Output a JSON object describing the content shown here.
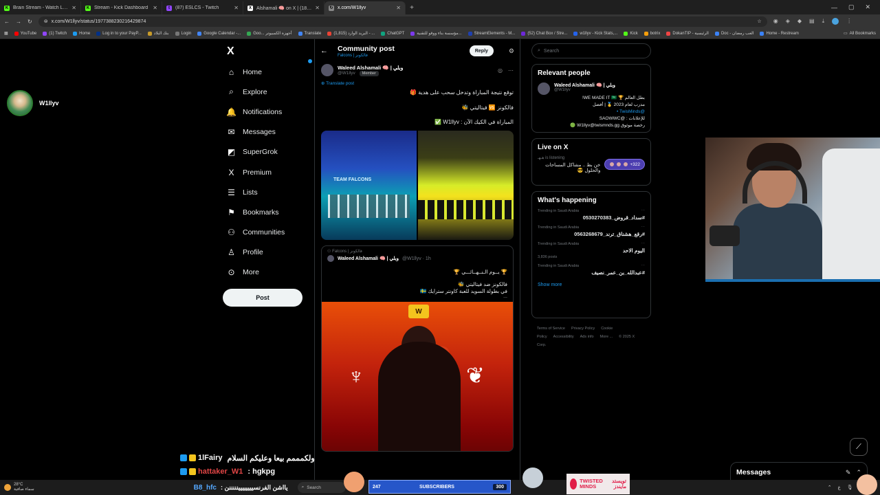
{
  "browser": {
    "tabs": [
      {
        "title": "Brain Stream - Watch Live on Kick",
        "fav_color": "#53fc18",
        "fav": "K",
        "active": false
      },
      {
        "title": "Stream - Kick Dashboard",
        "fav_color": "#53fc18",
        "fav": "K",
        "active": false
      },
      {
        "title": "(87) ESLCS - Twitch",
        "fav_color": "#9146ff",
        "fav": "t",
        "active": false
      },
      {
        "title": "Alshamali 🧠 on X | وبلي (18)",
        "fav_color": "#ffffff",
        "fav": "X",
        "active": false
      },
      {
        "title": "x.com/W1llyv",
        "fav_color": "#888888",
        "fav": "↻",
        "active": true
      }
    ],
    "new_tab": "+",
    "url": "x.com/W1llyv/status/1977388230216429874",
    "bookmarks": [
      {
        "label": "YouTube",
        "color": "#ff0000"
      },
      {
        "label": "(1) Twitch",
        "color": "#9146ff"
      },
      {
        "label": "Home",
        "color": "#1d9bf0"
      },
      {
        "label": "Log in to your PayP...",
        "color": "#003087"
      },
      {
        "label": "بنك البلاد",
        "color": "#c89b2a"
      },
      {
        "label": "Login",
        "color": "#777777"
      },
      {
        "label": "Google Calendar -...",
        "color": "#4285f4"
      },
      {
        "label": "Goo... أجهزة الكمبيوتر",
        "color": "#34a853"
      },
      {
        "label": "Translate",
        "color": "#4285f4"
      },
      {
        "label": "(1,815) البريد الوارد - ...",
        "color": "#ea4335"
      },
      {
        "label": "ChatGPT",
        "color": "#10a37f"
      },
      {
        "label": "مؤسسة بناء ووقو للتقنية...",
        "color": "#7c3aed"
      },
      {
        "label": "StreamElements - M...",
        "color": "#1e40af"
      },
      {
        "label": "(52) Chat Box / Stre...",
        "color": "#6d28d9"
      },
      {
        "label": "w1llyv - Kick Stats,...",
        "color": "#2563eb"
      },
      {
        "label": "Kick",
        "color": "#53fc18"
      },
      {
        "label": "botrix",
        "color": "#f59e0b"
      },
      {
        "label": "DokanTIP - الرئيسية",
        "color": "#ef4444"
      },
      {
        "label": "Doc - العب رمضان",
        "color": "#3b82f6"
      },
      {
        "label": "Home - Restream",
        "color": "#3b82f6"
      }
    ],
    "all_bookmarks": "All Bookmarks"
  },
  "streamer": {
    "name": "W1llyv"
  },
  "x_nav": {
    "logo": "X",
    "items": [
      {
        "label": "Home",
        "icon": "home-icon",
        "glyph": "⌂"
      },
      {
        "label": "Explore",
        "icon": "search-icon",
        "glyph": "⌕"
      },
      {
        "label": "Notifications",
        "icon": "bell-icon",
        "glyph": "🔔"
      },
      {
        "label": "Messages",
        "icon": "envelope-icon",
        "glyph": "✉"
      },
      {
        "label": "SuperGrok",
        "icon": "grok-icon",
        "glyph": "◩"
      },
      {
        "label": "Premium",
        "icon": "x-premium-icon",
        "glyph": "X"
      },
      {
        "label": "Lists",
        "icon": "list-icon",
        "glyph": "☰"
      },
      {
        "label": "Bookmarks",
        "icon": "bookmark-icon",
        "glyph": "⚑"
      },
      {
        "label": "Communities",
        "icon": "communities-icon",
        "glyph": "⚇"
      },
      {
        "label": "Profile",
        "icon": "profile-icon",
        "glyph": "♙"
      },
      {
        "label": "More",
        "icon": "more-circle-icon",
        "glyph": "⊙"
      }
    ],
    "post_button": "Post"
  },
  "post": {
    "header_title": "Community post",
    "community": "Falcons | فالكونز",
    "reply_button": "Reply",
    "author_name": "Waleed Alshamali 🧠 | وبلي",
    "author_handle": "@W1llyv",
    "member_badge": "Member",
    "translate": "Translate post",
    "lines": [
      "توقع نتيجة المباراة وتدخل سحب على هدية 🎁",
      "فالكونز 🆚 فيتاليتي 🐝",
      "المباراة في الكيك الآن : W1llyv ✅"
    ],
    "image_sign": "TEAM FALCONS",
    "quote": {
      "community": "Falcons | فالكونز",
      "author_name": "Waleed Alshamali 🧠 | وبلي",
      "author_handle": "@W1llyv · 1h",
      "lines": [
        "🏆 يــوم الـنــهــائـــي 🏆",
        "فالكونز ضد فيتاليتي 🐝",
        "في بطولة السويد للعبة كاونتر سترايك 🇸🇪"
      ],
      "ellipsis": "..."
    }
  },
  "right": {
    "search_placeholder": "Search",
    "relevant_title": "Relevant people",
    "rp_name": "Waleed Alshamali 🧠 | وبلي",
    "rp_handle": "@W1llyv",
    "rp_bio_1": "بطل العالم 🏆 WE MADE IT 🇸🇦!",
    "rp_bio_2": "مدرب لعام 2023 🥇 | أفضل",
    "rp_bio_3": "@TwisMinds •",
    "rp_bio_4": "للإعلانات : @SAOWWC",
    "rp_bio_5": "رخصة موثوق W1llyv@twismnds.gg 🟢",
    "live_title": "Live on X",
    "live_host": "هـهـ is listening",
    "live_space_title": "خن بظ .. مشاكل المساحات والحلول 😎",
    "live_count": "+322",
    "whats_title": "What's happening",
    "trends": [
      {
        "category": "Trending in Saudi Arabia",
        "topic": "#سداد_قروض_0530270383",
        "count": ""
      },
      {
        "category": "Trending in Saudi Arabia",
        "topic": "#رقع_هشناق_ترند_0563268679",
        "count": ""
      },
      {
        "category": "Trending in Saudi Arabia",
        "topic": "اليوم الاحد",
        "count": "3,836 posts"
      },
      {
        "category": "Trending in Saudi Arabia",
        "topic": "#عبدالله_بن_عمر_نصيف",
        "count": ""
      }
    ],
    "show_more": "Show more",
    "footer": [
      "Terms of Service",
      "Privacy Policy",
      "Cookie Policy",
      "Accessibility",
      "Ads info",
      "More ...",
      "© 2025 X Corp."
    ]
  },
  "overlay": {
    "chat": [
      {
        "user": "1lFairy",
        "message": "ولكمممم بيعا وعليكم السلام"
      },
      {
        "user": "hattaker_W1",
        "message": "hgkpg"
      }
    ],
    "ticker_user": "B8_hfc",
    "ticker_msg": "يااشن الفرنسيييييييينننننن :",
    "subs_count": "247",
    "subs_label": "SUBSCRIBERS",
    "subs_goal": "300",
    "sponsor_en": "TWISTED MINDS",
    "sponsor_ar": "تويستد مايندز",
    "messages_dock": "Messages"
  },
  "taskbar": {
    "weather_temp": "28°C",
    "weather_desc": "سماء صافية",
    "search": "Search",
    "lang": "ع"
  }
}
